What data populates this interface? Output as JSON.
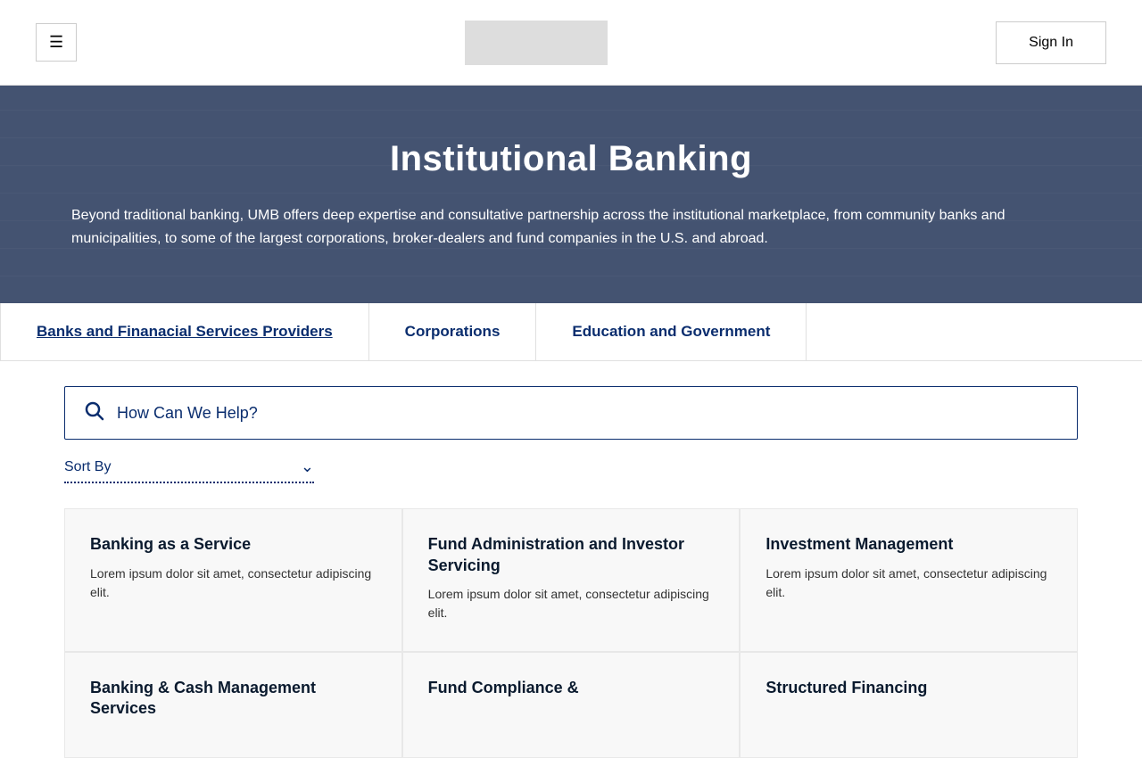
{
  "header": {
    "menu_label": "☰",
    "sign_in_label": "Sign In"
  },
  "hero": {
    "title": "Institutional Banking",
    "description": "Beyond traditional banking, UMB offers deep expertise and consultative partnership across the institutional marketplace, from community banks and municipalities, to some of the largest corporations, broker-dealers and fund companies in the U.S. and abroad."
  },
  "tabs": [
    {
      "id": "banks",
      "label": "Banks and Finanacial Services Providers",
      "active": true
    },
    {
      "id": "corporations",
      "label": "Corporations",
      "active": false
    },
    {
      "id": "education",
      "label": "Education and Government",
      "active": false
    }
  ],
  "search": {
    "placeholder": "How Can We Help?"
  },
  "sort": {
    "label": "Sort By"
  },
  "cards": [
    {
      "id": "card1",
      "title": "Banking as a Service",
      "description": "Lorem ipsum dolor sit amet, consectetur adipiscing elit."
    },
    {
      "id": "card2",
      "title": "Fund Administration and Investor Servicing",
      "description": "Lorem ipsum dolor sit amet, consectetur adipiscing elit."
    },
    {
      "id": "card3",
      "title": "Investment Management",
      "description": "Lorem ipsum dolor sit amet, consectetur adipiscing elit."
    },
    {
      "id": "card4",
      "title": "Banking & Cash Management Services",
      "description": ""
    },
    {
      "id": "card5",
      "title": "Fund Compliance &",
      "description": ""
    },
    {
      "id": "card6",
      "title": "Structured Financing",
      "description": ""
    }
  ]
}
